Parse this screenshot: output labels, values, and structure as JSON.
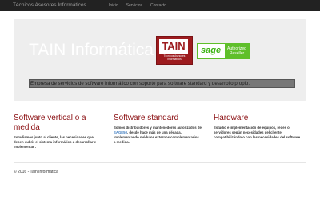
{
  "navbar": {
    "brand": "Técnicos Asesores Informáticos",
    "links": [
      "Inicio",
      "Servicios",
      "Contacto"
    ]
  },
  "jumbotron": {
    "title": "TAIN Informática",
    "description": "Empresa de servicios de software informático con soporte para software standard y desarrollo propio.",
    "logo": {
      "word": "TAIN",
      "subtitle_line1": "Técnicos Asesores",
      "subtitle_line2": "Informáticos"
    },
    "sage_badge": {
      "word": "sage",
      "line1": "Authorized",
      "line2": "Reseller"
    }
  },
  "columns": [
    {
      "title": "Software vertical o a medida",
      "text": "Estudiamos junto al cliente, las necesidades que deben cubrir el sistema informático a desarrollar e implementar ."
    },
    {
      "title": "Software standard",
      "text_before": "Somos distribuidores y mantenedores autorizados de",
      "link": "SAGE50",
      "text_after": ", desde hace más de una década, implementando módulos externos complementarios a medida."
    },
    {
      "title": "Hardware",
      "text": "Estudio e implementación de equipos, redes o servidores según necesidades del cliente, compatibilizándolo con las necesidades del software."
    }
  ],
  "footer": {
    "text": "© 2016 - Tain Informática"
  },
  "colors": {
    "navbar_bg": "#222222",
    "accent_red": "#8b0f12",
    "sage_green": "#5fbf2a",
    "link_blue": "#3b7abf"
  }
}
